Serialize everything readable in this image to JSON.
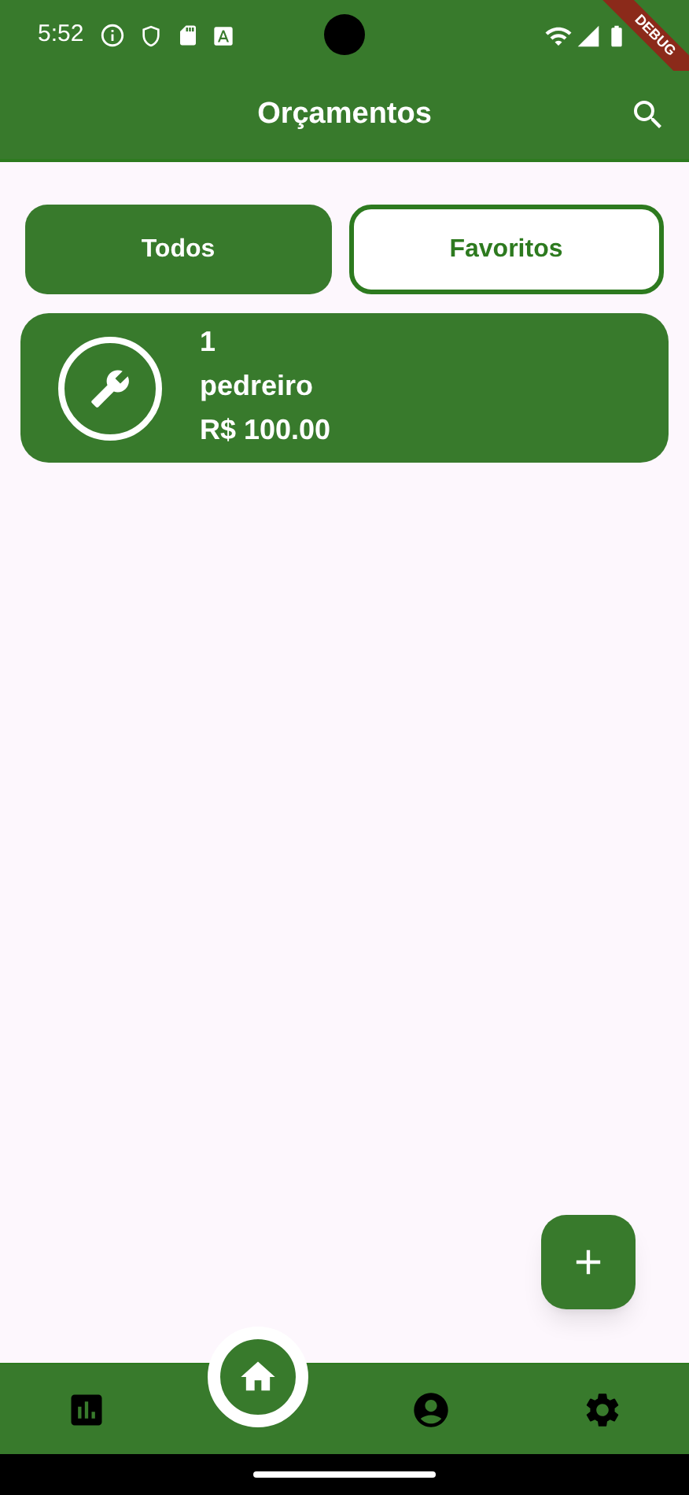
{
  "status_bar": {
    "time": "5:52"
  },
  "debug_banner": {
    "label": "DEBUG"
  },
  "app_bar": {
    "title": "Orçamentos"
  },
  "tabs": [
    {
      "label": "Todos",
      "selected": true
    },
    {
      "label": "Favoritos",
      "selected": false
    }
  ],
  "budgets": [
    {
      "number": "1",
      "name": "pedreiro",
      "price": "R$ 100.00"
    }
  ],
  "nav": [
    {
      "kind": "stats",
      "selected": false
    },
    {
      "kind": "home",
      "selected": true
    },
    {
      "kind": "profile",
      "selected": false
    },
    {
      "kind": "settings",
      "selected": false
    }
  ]
}
